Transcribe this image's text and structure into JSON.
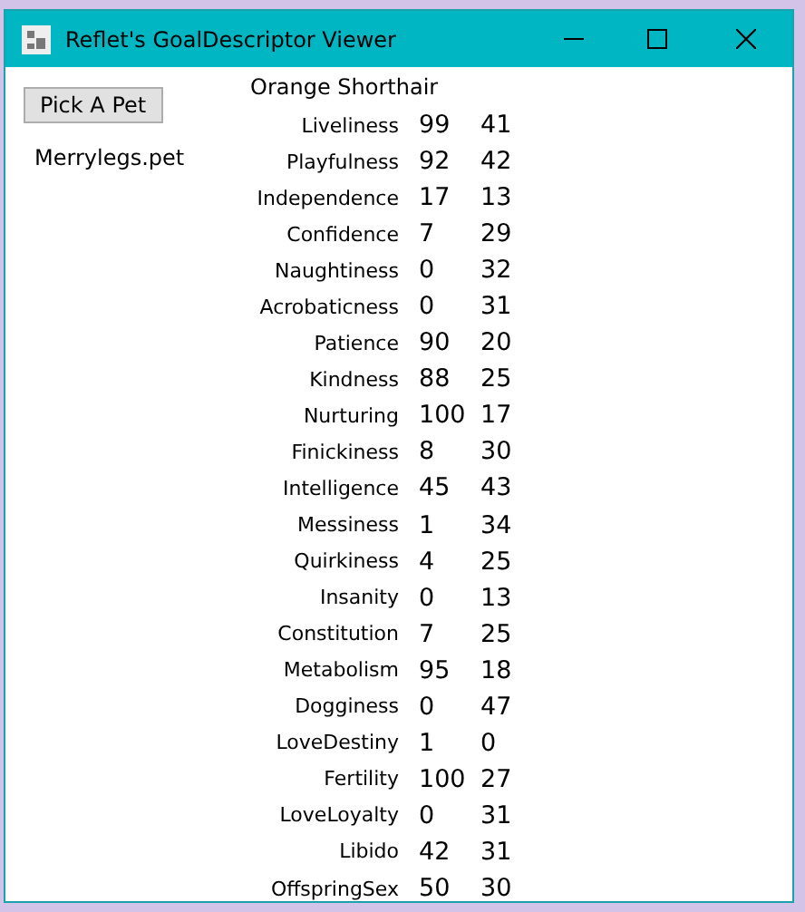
{
  "window": {
    "title": "Reflet's GoalDescriptor Viewer"
  },
  "pick_button": "Pick A Pet",
  "file_name": "Merrylegs.pet",
  "breed": "Orange Shorthair",
  "traits": [
    {
      "name": "Liveliness",
      "column_2": "99",
      "column_3": "41"
    },
    {
      "name": "Playfulness",
      "column_2": "92",
      "column_3": "42"
    },
    {
      "name": "Independence",
      "column_2": "17",
      "column_3": "13"
    },
    {
      "name": "Confidence",
      "column_2": "7",
      "column_3": "29"
    },
    {
      "name": "Naughtiness",
      "column_2": "0",
      "column_3": "32"
    },
    {
      "name": "Acrobaticness",
      "column_2": "0",
      "column_3": "31"
    },
    {
      "name": "Patience",
      "column_2": "90",
      "column_3": "20"
    },
    {
      "name": "Kindness",
      "column_2": "88",
      "column_3": "25"
    },
    {
      "name": "Nurturing",
      "column_2": "100",
      "column_3": "17"
    },
    {
      "name": "Finickiness",
      "column_2": "8",
      "column_3": "30"
    },
    {
      "name": "Intelligence",
      "column_2": "45",
      "column_3": "43"
    },
    {
      "name": "Messiness",
      "column_2": "1",
      "column_3": "34"
    },
    {
      "name": "Quirkiness",
      "column_2": "4",
      "column_3": "25"
    },
    {
      "name": "Insanity",
      "column_2": "0",
      "column_3": "13"
    },
    {
      "name": "Constitution",
      "column_2": "7",
      "column_3": "25"
    },
    {
      "name": "Metabolism",
      "column_2": "95",
      "column_3": "18"
    },
    {
      "name": "Dogginess",
      "column_2": "0",
      "column_3": "47"
    },
    {
      "name": "LoveDestiny",
      "column_2": "1",
      "column_3": "0"
    },
    {
      "name": "Fertility",
      "column_2": "100",
      "column_3": "27"
    },
    {
      "name": "LoveLoyalty",
      "column_2": "0",
      "column_3": "31"
    },
    {
      "name": "Libido",
      "column_2": "42",
      "column_3": "31"
    },
    {
      "name": "OffspringSex",
      "column_2": "50",
      "column_3": "30"
    }
  ]
}
